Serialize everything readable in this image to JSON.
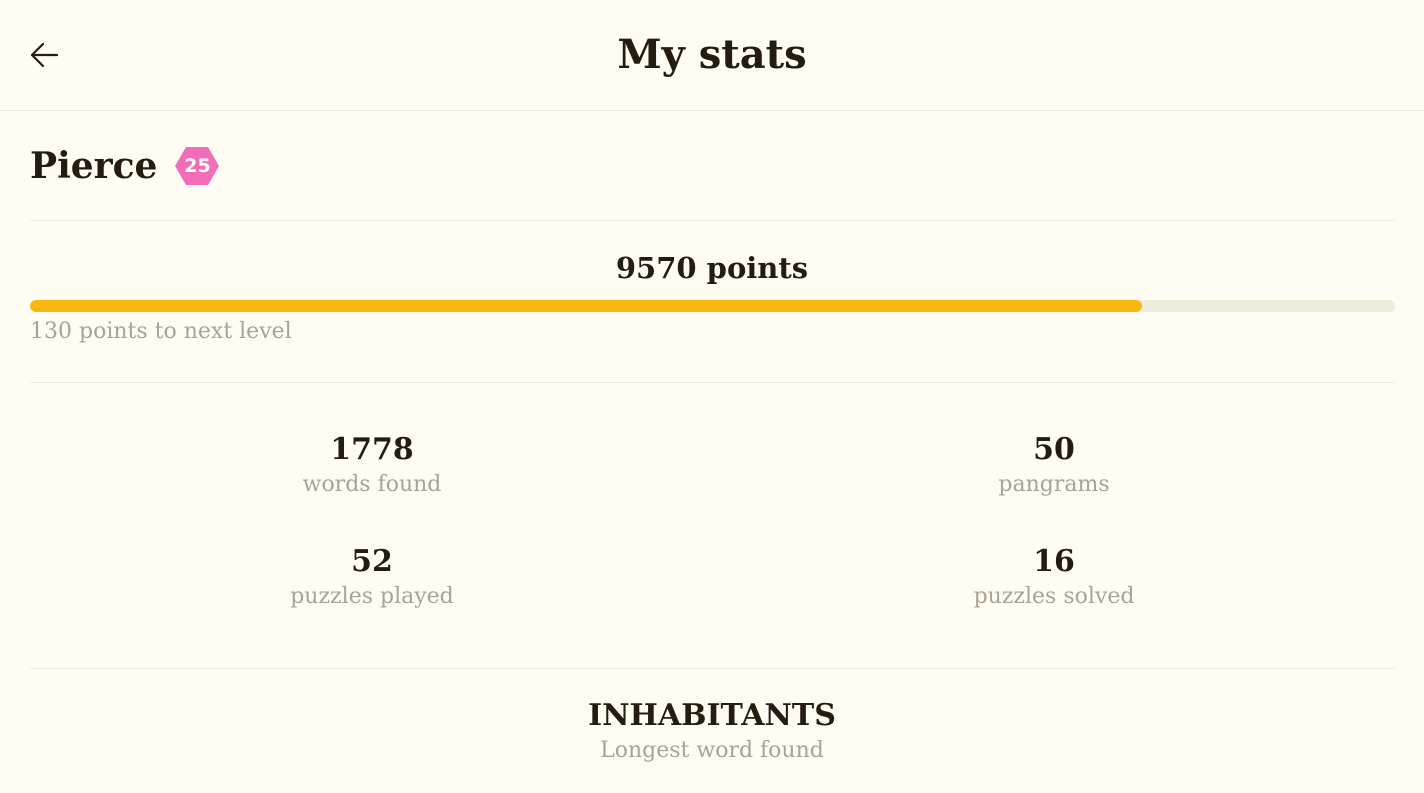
{
  "header": {
    "title": "My stats",
    "back_icon": "arrow-left-icon"
  },
  "profile": {
    "name": "Pierce",
    "level": "25",
    "badge_color": "#f26cb8"
  },
  "progress": {
    "points_label": "9570 points",
    "next_level_label": "130 points to next level",
    "fraction": 0.815,
    "fill_color": "#f8b80f",
    "track_color": "#f0ecdc"
  },
  "stats": [
    {
      "value": "1778",
      "label": "words found"
    },
    {
      "value": "50",
      "label": "pangrams"
    },
    {
      "value": "52",
      "label": "puzzles played"
    },
    {
      "value": "16",
      "label": "puzzles solved"
    }
  ],
  "longest": {
    "word": "INHABITANTS",
    "label": "Longest word found"
  }
}
